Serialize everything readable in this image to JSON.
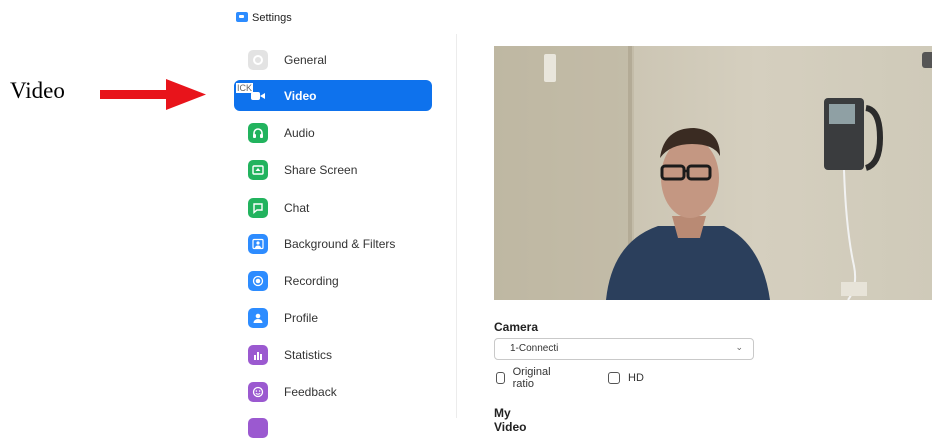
{
  "annotation": {
    "label": "Video",
    "arrow_color": "#e8141b"
  },
  "window": {
    "title": "Settings",
    "app_icon": "zoom-app-icon"
  },
  "sidebar": {
    "ghost_text": "ICK",
    "active_color": "#0e72ed",
    "items": [
      {
        "label": "General",
        "icon": "gear-icon",
        "color": "#d9d9d9",
        "active": false
      },
      {
        "label": "Video",
        "icon": "video-camera-icon",
        "color": "#0e72ed",
        "active": true
      },
      {
        "label": "Audio",
        "icon": "headphones-icon",
        "color": "#22b35e",
        "active": false
      },
      {
        "label": "Share Screen",
        "icon": "share-screen-icon",
        "color": "#22b35e",
        "active": false
      },
      {
        "label": "Chat",
        "icon": "chat-bubble-icon",
        "color": "#22b35e",
        "active": false
      },
      {
        "label": "Background & Filters",
        "icon": "background-person-icon",
        "color": "#2d8cff",
        "active": false
      },
      {
        "label": "Recording",
        "icon": "record-icon",
        "color": "#2d8cff",
        "active": false
      },
      {
        "label": "Profile",
        "icon": "profile-person-icon",
        "color": "#2d8cff",
        "active": false
      },
      {
        "label": "Statistics",
        "icon": "bar-chart-icon",
        "color": "#9b59d0",
        "active": false
      },
      {
        "label": "Feedback",
        "icon": "smiley-icon",
        "color": "#9b59d0",
        "active": false
      }
    ]
  },
  "video": {
    "preview_icon": "rotate-camera-icon",
    "camera_label": "Camera",
    "camera_value": "1-Connecti",
    "select_caret_icon": "chevron-down-icon",
    "original_ratio_label": "Original ratio",
    "original_ratio_checked": false,
    "hd_label": "HD",
    "hd_checked": false,
    "my_video_label": "My Video"
  }
}
